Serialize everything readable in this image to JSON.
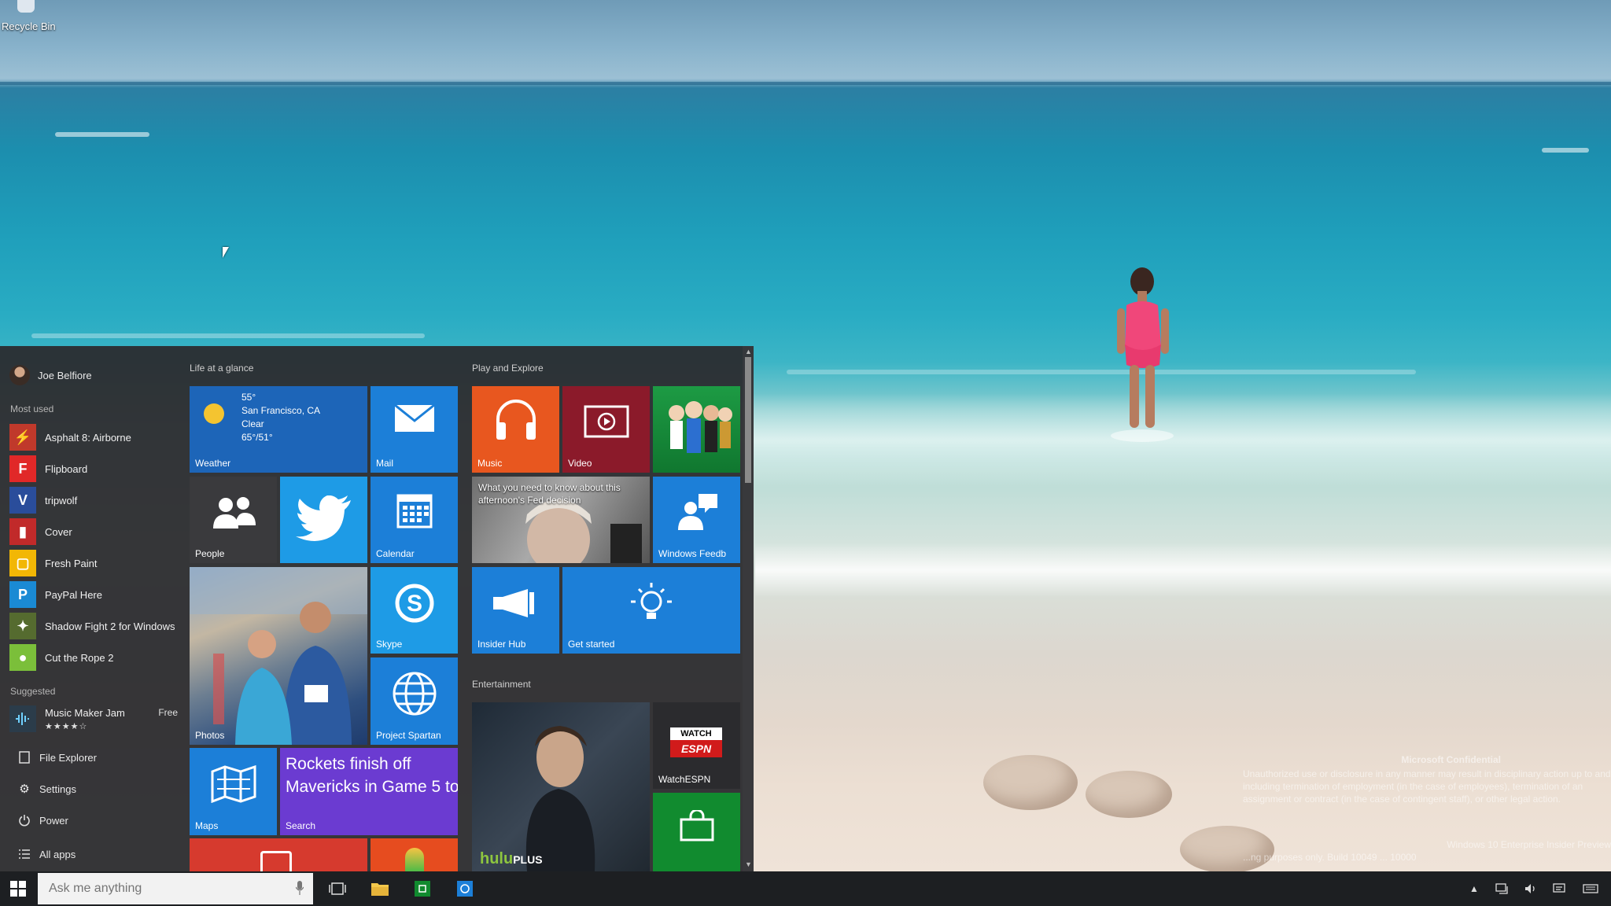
{
  "desktop": {
    "recycle_bin_label": "Recycle Bin",
    "watermark": {
      "title": "Microsoft Confidential",
      "body": "Unauthorized use or disclosure in any manner may result in disciplinary action up to and including termination of employment (in the case of employees), termination of an assignment or contract (in the case of contingent staff), or other legal action.",
      "build": "Windows 10 Enterprise Insider Preview",
      "footer": "...ng purposes only. Build 10049 ... 10000"
    }
  },
  "start_menu": {
    "user_name": "Joe Belfiore",
    "most_used_label": "Most used",
    "most_used": [
      {
        "name": "Asphalt 8: Airborne",
        "icon": "asphalt-icon",
        "color": "#c0392b"
      },
      {
        "name": "Flipboard",
        "icon": "flipboard-icon",
        "color": "#e12828"
      },
      {
        "name": "tripwolf",
        "icon": "tripwolf-icon",
        "color": "#2a4d9b"
      },
      {
        "name": "Cover",
        "icon": "cover-icon",
        "color": "#c12a2a"
      },
      {
        "name": "Fresh Paint",
        "icon": "fresh-paint-icon",
        "color": "#f2b705"
      },
      {
        "name": "PayPal Here",
        "icon": "paypal-icon",
        "color": "#1a8ad4"
      },
      {
        "name": "Shadow Fight 2 for Windows",
        "icon": "shadow-fight-icon",
        "color": "#556b2f"
      },
      {
        "name": "Cut the Rope 2",
        "icon": "cut-the-rope-icon",
        "color": "#7bbf3a"
      }
    ],
    "suggested_label": "Suggested",
    "suggested": {
      "name": "Music Maker Jam",
      "price": "Free",
      "stars": "★★★★☆"
    },
    "bottom": {
      "file_explorer": "File Explorer",
      "settings": "Settings",
      "power": "Power",
      "all_apps": "All apps"
    },
    "groups": {
      "life": "Life at a glance",
      "play": "Play and Explore",
      "entertainment": "Entertainment"
    },
    "tiles": {
      "weather": {
        "label": "Weather",
        "temp": "55°",
        "city": "San Francisco, CA",
        "condition": "Clear",
        "range": "65°/51°"
      },
      "mail": "Mail",
      "people": "People",
      "twitter": "",
      "calendar": "Calendar",
      "photos": "Photos",
      "skype": "Skype",
      "spartan": "Project Spartan",
      "maps": "Maps",
      "search": {
        "label": "Search",
        "headline": "Rockets finish off Mavericks in Game 5 to"
      },
      "music": "Music",
      "video": "Video",
      "news": {
        "headline": "What you need to know about this afternoon's Fed decision"
      },
      "feedback": "Windows Feedb",
      "insider": "Insider Hub",
      "get_started": "Get started",
      "hulu": {
        "logo_a": "hulu",
        "logo_b": "PLUS"
      },
      "espn": {
        "label": "WatchESPN",
        "logo_a": "WATCH",
        "logo_b": "ESPN"
      }
    },
    "colors": {
      "blue": "#1c7fd8",
      "light_blue": "#1e9be6",
      "orange": "#e8571f",
      "maroon": "#8b1a2a",
      "purple": "#6b3bd1",
      "green": "#118b2f"
    }
  },
  "taskbar": {
    "search_placeholder": "Ask me anything"
  }
}
